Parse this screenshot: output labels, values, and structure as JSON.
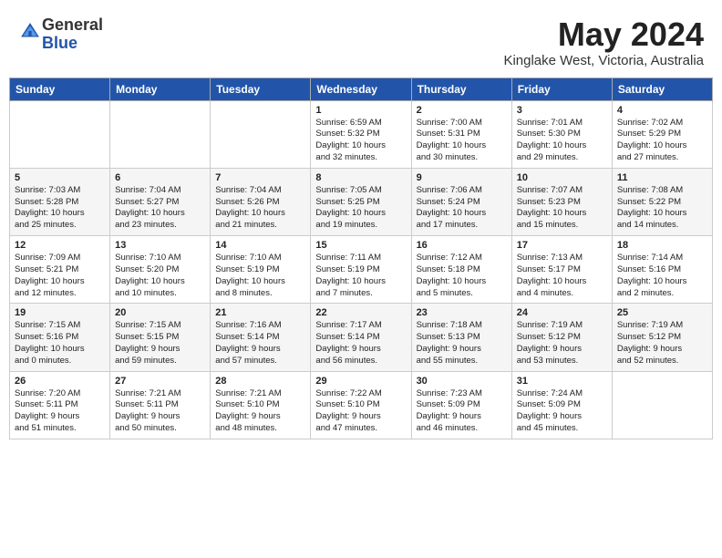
{
  "header": {
    "logo_general": "General",
    "logo_blue": "Blue",
    "cal_title": "May 2024",
    "cal_subtitle": "Kinglake West, Victoria, Australia"
  },
  "days_of_week": [
    "Sunday",
    "Monday",
    "Tuesday",
    "Wednesday",
    "Thursday",
    "Friday",
    "Saturday"
  ],
  "weeks": [
    [
      {
        "day": "",
        "info": ""
      },
      {
        "day": "",
        "info": ""
      },
      {
        "day": "",
        "info": ""
      },
      {
        "day": "1",
        "info": "Sunrise: 6:59 AM\nSunset: 5:32 PM\nDaylight: 10 hours\nand 32 minutes."
      },
      {
        "day": "2",
        "info": "Sunrise: 7:00 AM\nSunset: 5:31 PM\nDaylight: 10 hours\nand 30 minutes."
      },
      {
        "day": "3",
        "info": "Sunrise: 7:01 AM\nSunset: 5:30 PM\nDaylight: 10 hours\nand 29 minutes."
      },
      {
        "day": "4",
        "info": "Sunrise: 7:02 AM\nSunset: 5:29 PM\nDaylight: 10 hours\nand 27 minutes."
      }
    ],
    [
      {
        "day": "5",
        "info": "Sunrise: 7:03 AM\nSunset: 5:28 PM\nDaylight: 10 hours\nand 25 minutes."
      },
      {
        "day": "6",
        "info": "Sunrise: 7:04 AM\nSunset: 5:27 PM\nDaylight: 10 hours\nand 23 minutes."
      },
      {
        "day": "7",
        "info": "Sunrise: 7:04 AM\nSunset: 5:26 PM\nDaylight: 10 hours\nand 21 minutes."
      },
      {
        "day": "8",
        "info": "Sunrise: 7:05 AM\nSunset: 5:25 PM\nDaylight: 10 hours\nand 19 minutes."
      },
      {
        "day": "9",
        "info": "Sunrise: 7:06 AM\nSunset: 5:24 PM\nDaylight: 10 hours\nand 17 minutes."
      },
      {
        "day": "10",
        "info": "Sunrise: 7:07 AM\nSunset: 5:23 PM\nDaylight: 10 hours\nand 15 minutes."
      },
      {
        "day": "11",
        "info": "Sunrise: 7:08 AM\nSunset: 5:22 PM\nDaylight: 10 hours\nand 14 minutes."
      }
    ],
    [
      {
        "day": "12",
        "info": "Sunrise: 7:09 AM\nSunset: 5:21 PM\nDaylight: 10 hours\nand 12 minutes."
      },
      {
        "day": "13",
        "info": "Sunrise: 7:10 AM\nSunset: 5:20 PM\nDaylight: 10 hours\nand 10 minutes."
      },
      {
        "day": "14",
        "info": "Sunrise: 7:10 AM\nSunset: 5:19 PM\nDaylight: 10 hours\nand 8 minutes."
      },
      {
        "day": "15",
        "info": "Sunrise: 7:11 AM\nSunset: 5:19 PM\nDaylight: 10 hours\nand 7 minutes."
      },
      {
        "day": "16",
        "info": "Sunrise: 7:12 AM\nSunset: 5:18 PM\nDaylight: 10 hours\nand 5 minutes."
      },
      {
        "day": "17",
        "info": "Sunrise: 7:13 AM\nSunset: 5:17 PM\nDaylight: 10 hours\nand 4 minutes."
      },
      {
        "day": "18",
        "info": "Sunrise: 7:14 AM\nSunset: 5:16 PM\nDaylight: 10 hours\nand 2 minutes."
      }
    ],
    [
      {
        "day": "19",
        "info": "Sunrise: 7:15 AM\nSunset: 5:16 PM\nDaylight: 10 hours\nand 0 minutes."
      },
      {
        "day": "20",
        "info": "Sunrise: 7:15 AM\nSunset: 5:15 PM\nDaylight: 9 hours\nand 59 minutes."
      },
      {
        "day": "21",
        "info": "Sunrise: 7:16 AM\nSunset: 5:14 PM\nDaylight: 9 hours\nand 57 minutes."
      },
      {
        "day": "22",
        "info": "Sunrise: 7:17 AM\nSunset: 5:14 PM\nDaylight: 9 hours\nand 56 minutes."
      },
      {
        "day": "23",
        "info": "Sunrise: 7:18 AM\nSunset: 5:13 PM\nDaylight: 9 hours\nand 55 minutes."
      },
      {
        "day": "24",
        "info": "Sunrise: 7:19 AM\nSunset: 5:12 PM\nDaylight: 9 hours\nand 53 minutes."
      },
      {
        "day": "25",
        "info": "Sunrise: 7:19 AM\nSunset: 5:12 PM\nDaylight: 9 hours\nand 52 minutes."
      }
    ],
    [
      {
        "day": "26",
        "info": "Sunrise: 7:20 AM\nSunset: 5:11 PM\nDaylight: 9 hours\nand 51 minutes."
      },
      {
        "day": "27",
        "info": "Sunrise: 7:21 AM\nSunset: 5:11 PM\nDaylight: 9 hours\nand 50 minutes."
      },
      {
        "day": "28",
        "info": "Sunrise: 7:21 AM\nSunset: 5:10 PM\nDaylight: 9 hours\nand 48 minutes."
      },
      {
        "day": "29",
        "info": "Sunrise: 7:22 AM\nSunset: 5:10 PM\nDaylight: 9 hours\nand 47 minutes."
      },
      {
        "day": "30",
        "info": "Sunrise: 7:23 AM\nSunset: 5:09 PM\nDaylight: 9 hours\nand 46 minutes."
      },
      {
        "day": "31",
        "info": "Sunrise: 7:24 AM\nSunset: 5:09 PM\nDaylight: 9 hours\nand 45 minutes."
      },
      {
        "day": "",
        "info": ""
      }
    ]
  ]
}
